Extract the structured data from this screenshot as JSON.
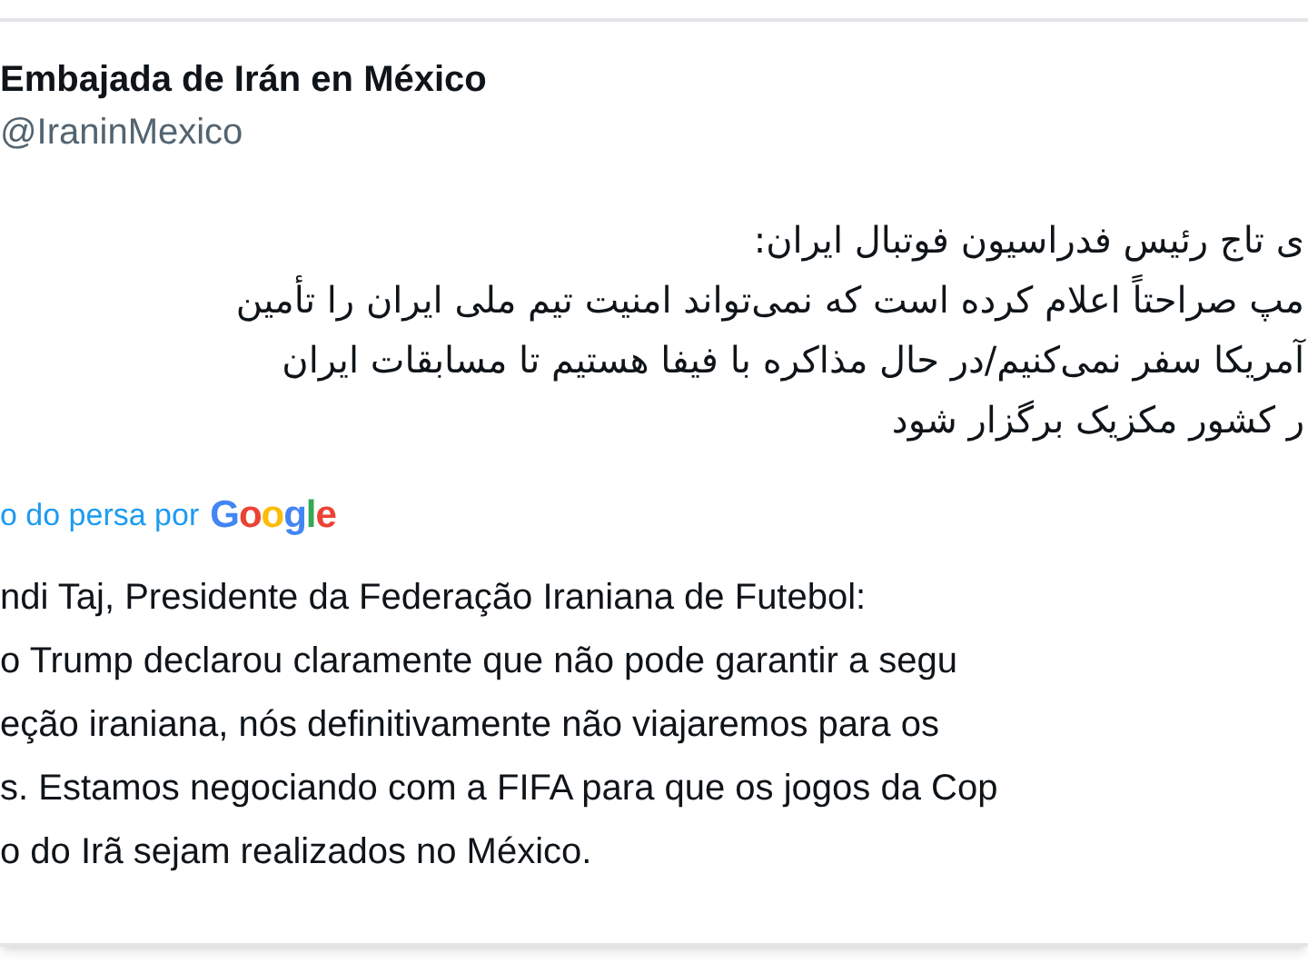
{
  "author": {
    "name": "Embajada de Irán en México",
    "handle": "@IraninMexico"
  },
  "original_lines": [
    "ی تاج رئیس فدراسیون فوتبال ایران:",
    "مپ صراحتاً اعلام کرده است که نمی‌تواند امنیت تیم ملی ایران را تأمین",
    "آمریکا سفر نمی‌کنیم/در حال مذاکره با فیفا هستیم تا مسابقات ایران",
    "ر کشور مکزیک برگزار شود"
  ],
  "translation_note": {
    "text": "o do persa por",
    "provider": "Google"
  },
  "translated_lines": [
    "ndi Taj, Presidente da Federação Iraniana de Futebol:",
    "o Trump declarou claramente que não pode garantir a segu",
    "eção iraniana, nós definitivamente não viajaremos para os",
    "s. Estamos negociando com a FIFA para que os jogos da Cop",
    "o do Irã sejam realizados no México."
  ]
}
